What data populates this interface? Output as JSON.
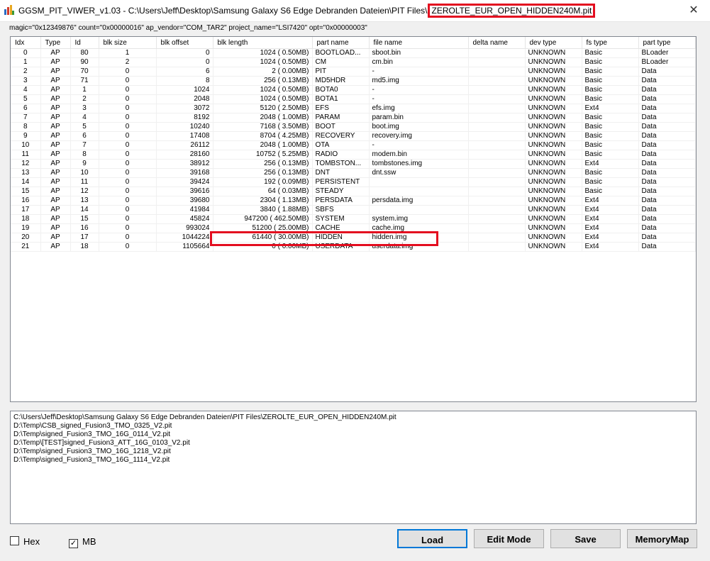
{
  "window": {
    "title_prefix": "GGSM_PIT_VIWER_v1.03 - C:\\Users\\Jeff\\Desktop\\Samsung Galaxy S6 Edge Debranden Dateien\\PIT Files\\",
    "title_file": "ZEROLTE_EUR_OPEN_HIDDEN240M.pit",
    "close_glyph": "✕"
  },
  "info_line": "magic=\"0x12349876\" count=\"0x00000016\" ap_vendor=\"COM_TAR2\" project_name=\"LSI7420\" opt=\"0x00000003\"",
  "columns": [
    "Idx",
    "Type",
    "Id",
    "blk size",
    "blk offset",
    "blk length",
    "part name",
    "file name",
    "delta name",
    "dev type",
    "fs type",
    "part type"
  ],
  "rows": [
    [
      "0",
      "AP",
      "80",
      "1",
      "0",
      "1024 ( 0.50MB)",
      "BOOTLOAD...",
      "sboot.bin",
      "",
      "UNKNOWN",
      "Basic",
      "BLoader"
    ],
    [
      "1",
      "AP",
      "90",
      "2",
      "0",
      "1024 ( 0.50MB)",
      "CM",
      "cm.bin",
      "",
      "UNKNOWN",
      "Basic",
      "BLoader"
    ],
    [
      "2",
      "AP",
      "70",
      "0",
      "6",
      "2 ( 0.00MB)",
      "PIT",
      "-",
      "",
      "UNKNOWN",
      "Basic",
      "Data"
    ],
    [
      "3",
      "AP",
      "71",
      "0",
      "8",
      "256 ( 0.13MB)",
      "MD5HDR",
      "md5.img",
      "",
      "UNKNOWN",
      "Basic",
      "Data"
    ],
    [
      "4",
      "AP",
      "1",
      "0",
      "1024",
      "1024 ( 0.50MB)",
      "BOTA0",
      "-",
      "",
      "UNKNOWN",
      "Basic",
      "Data"
    ],
    [
      "5",
      "AP",
      "2",
      "0",
      "2048",
      "1024 ( 0.50MB)",
      "BOTA1",
      "-",
      "",
      "UNKNOWN",
      "Basic",
      "Data"
    ],
    [
      "6",
      "AP",
      "3",
      "0",
      "3072",
      "5120 ( 2.50MB)",
      "EFS",
      "efs.img",
      "",
      "UNKNOWN",
      "Ext4",
      "Data"
    ],
    [
      "7",
      "AP",
      "4",
      "0",
      "8192",
      "2048 ( 1.00MB)",
      "PARAM",
      "param.bin",
      "",
      "UNKNOWN",
      "Basic",
      "Data"
    ],
    [
      "8",
      "AP",
      "5",
      "0",
      "10240",
      "7168 ( 3.50MB)",
      "BOOT",
      "boot.img",
      "",
      "UNKNOWN",
      "Basic",
      "Data"
    ],
    [
      "9",
      "AP",
      "6",
      "0",
      "17408",
      "8704 ( 4.25MB)",
      "RECOVERY",
      "recovery.img",
      "",
      "UNKNOWN",
      "Basic",
      "Data"
    ],
    [
      "10",
      "AP",
      "7",
      "0",
      "26112",
      "2048 ( 1.00MB)",
      "OTA",
      "-",
      "",
      "UNKNOWN",
      "Basic",
      "Data"
    ],
    [
      "11",
      "AP",
      "8",
      "0",
      "28160",
      "10752 ( 5.25MB)",
      "RADIO",
      "modem.bin",
      "",
      "UNKNOWN",
      "Basic",
      "Data"
    ],
    [
      "12",
      "AP",
      "9",
      "0",
      "38912",
      "256 ( 0.13MB)",
      "TOMBSTON...",
      "tombstones.img",
      "",
      "UNKNOWN",
      "Ext4",
      "Data"
    ],
    [
      "13",
      "AP",
      "10",
      "0",
      "39168",
      "256 ( 0.13MB)",
      "DNT",
      "dnt.ssw",
      "",
      "UNKNOWN",
      "Basic",
      "Data"
    ],
    [
      "14",
      "AP",
      "11",
      "0",
      "39424",
      "192 ( 0.09MB)",
      "PERSISTENT",
      "",
      "",
      "UNKNOWN",
      "Basic",
      "Data"
    ],
    [
      "15",
      "AP",
      "12",
      "0",
      "39616",
      "64 ( 0.03MB)",
      "STEADY",
      "",
      "",
      "UNKNOWN",
      "Basic",
      "Data"
    ],
    [
      "16",
      "AP",
      "13",
      "0",
      "39680",
      "2304 ( 1.13MB)",
      "PERSDATA",
      "persdata.img",
      "",
      "UNKNOWN",
      "Ext4",
      "Data"
    ],
    [
      "17",
      "AP",
      "14",
      "0",
      "41984",
      "3840 ( 1.88MB)",
      "SBFS",
      "",
      "",
      "UNKNOWN",
      "Ext4",
      "Data"
    ],
    [
      "18",
      "AP",
      "15",
      "0",
      "45824",
      "947200 ( 462.50MB)",
      "SYSTEM",
      "system.img",
      "",
      "UNKNOWN",
      "Ext4",
      "Data"
    ],
    [
      "19",
      "AP",
      "16",
      "0",
      "993024",
      "51200 ( 25.00MB)",
      "CACHE",
      "cache.img",
      "",
      "UNKNOWN",
      "Ext4",
      "Data"
    ],
    [
      "20",
      "AP",
      "17",
      "0",
      "1044224",
      "61440 ( 30.00MB)",
      "HIDDEN",
      "hidden.img",
      "",
      "UNKNOWN",
      "Ext4",
      "Data"
    ],
    [
      "21",
      "AP",
      "18",
      "0",
      "1105664",
      "0 ( 0.00MB)",
      "USERDATA",
      "userdata.img",
      "",
      "UNKNOWN",
      "Ext4",
      "Data"
    ]
  ],
  "files": [
    "C:\\Users\\Jeff\\Desktop\\Samsung Galaxy S6 Edge Debranden Dateien\\PIT Files\\ZEROLTE_EUR_OPEN_HIDDEN240M.pit",
    "D:\\Temp\\CSB_signed_Fusion3_TMO_0325_V2.pit",
    "D:\\Temp\\signed_Fusion3_TMO_16G_0114_V2.pit",
    "D:\\Temp\\[TEST]signed_Fusion3_ATT_16G_0103_V2.pit",
    "D:\\Temp\\signed_Fusion3_TMO_16G_1218_V2.pit",
    "D:\\Temp\\signed_Fusion3_TMO_16G_1114_V2.pit"
  ],
  "checkboxes": {
    "hex": {
      "label": "Hex",
      "checked": false,
      "mark": ""
    },
    "mb": {
      "label": "MB",
      "checked": true,
      "mark": "✓"
    }
  },
  "buttons": {
    "load": "Load",
    "edit_mode": "Edit Mode",
    "save": "Save",
    "memory_map": "MemoryMap"
  },
  "colors": {
    "highlight": "#e30d1f",
    "focus": "#0078d7"
  }
}
